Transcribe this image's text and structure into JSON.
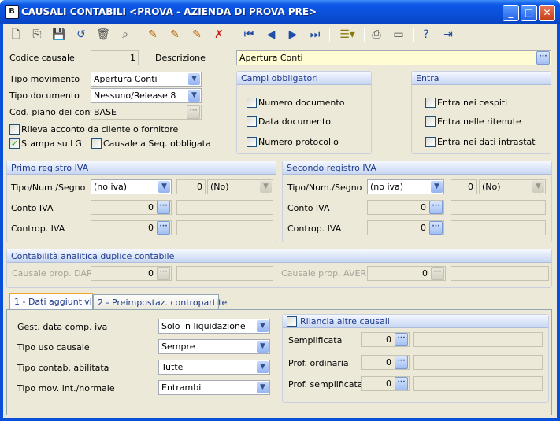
{
  "window": {
    "icon_label": "B",
    "title": "CAUSALI CONTABILI <PROVA - AZIENDA DI PROVA PRE>",
    "minimize": "_",
    "maximize": "□",
    "close": "✕"
  },
  "toolbar": {
    "icons": [
      "new-document-icon",
      "copy-icon",
      "save-icon",
      "undo-icon",
      "delete-icon",
      "find-icon",
      "edit-pencil-icon",
      "edit-pencil-2-icon",
      "edit-pencil-3-icon",
      "cancel-pencil-icon",
      "first-record-icon",
      "previous-record-icon",
      "next-record-icon",
      "last-record-icon",
      "list-view-icon",
      "print-icon",
      "preview-icon",
      "help-icon",
      "exit-icon"
    ]
  },
  "header": {
    "codice_causale_label": "Codice causale",
    "codice_causale_value": "1",
    "descrizione_label": "Descrizione",
    "descrizione_value": "Apertura Conti",
    "tipo_movimento_label": "Tipo movimento",
    "tipo_movimento_value": "Apertura Conti",
    "tipo_documento_label": "Tipo documento",
    "tipo_documento_value": "Nessuno/Release 8",
    "cod_piano_label": "Cod. piano dei conti",
    "cod_piano_value": "BASE",
    "rileva_acconto_label": "Rileva acconto da cliente o fornitore",
    "stampa_lg_label": "Stampa  su LG",
    "causale_seq_label": "Causale a Seq. obbligata"
  },
  "campi_obbligatori": {
    "title": "Campi obbligatori",
    "items": [
      "Numero documento",
      "Data documento",
      "Numero protocollo"
    ]
  },
  "entra": {
    "title": "Entra",
    "items": [
      "Entra nei cespiti",
      "Entra nelle ritenute",
      "Entra nei dati intrastat"
    ]
  },
  "primo_registro": {
    "title": "Primo registro IVA",
    "tipo_label": "Tipo/Num./Segno",
    "tipo_value": "(no iva)",
    "num_value": "0",
    "segno_value": "(No)",
    "conto_label": "Conto IVA",
    "conto_value": "0",
    "controp_label": "Controp. IVA",
    "controp_value": "0"
  },
  "secondo_registro": {
    "title": "Secondo registro IVA",
    "tipo_label": "Tipo/Num./Segno",
    "tipo_value": "(no iva)",
    "num_value": "0",
    "segno_value": "(No)",
    "conto_label": "Conto IVA",
    "conto_value": "0",
    "controp_label": "Controp. IVA",
    "controp_value": "0"
  },
  "analitica": {
    "title": "Contabilità analitica duplice contabile",
    "dare_label": "Causale prop. DARE",
    "dare_value": "0",
    "avere_label": "Causale prop. AVERE",
    "avere_value": "0"
  },
  "tabs": [
    {
      "label": "1 - Dati aggiuntivi",
      "active": true
    },
    {
      "label": "2 - Preimpostaz. contropartite",
      "active": false
    }
  ],
  "dati_aggiuntivi": {
    "gest_data_label": "Gest. data comp. iva",
    "gest_data_value": "Solo in liquidazione",
    "tipo_uso_label": "Tipo uso causale",
    "tipo_uso_value": "Sempre",
    "tipo_contab_label": "Tipo contab. abilitata",
    "tipo_contab_value": "Tutte",
    "tipo_mov_label": "Tipo mov. int./normale",
    "tipo_mov_value": "Entrambi"
  },
  "rilancia": {
    "title": "Rilancia altre causali",
    "semplificata_label": "Semplificata",
    "semplificata_value": "0",
    "prof_ordinaria_label": "Prof. ordinaria",
    "prof_ordinaria_value": "0",
    "prof_semplificata_label": "Prof. semplificata",
    "prof_semplificata_value": "0"
  },
  "colors": {
    "titlebar": "#0a4fd8",
    "window_bg": "#ece9d8",
    "description_bg": "#fffbd3",
    "group_header_text": "#1d3a8a"
  }
}
